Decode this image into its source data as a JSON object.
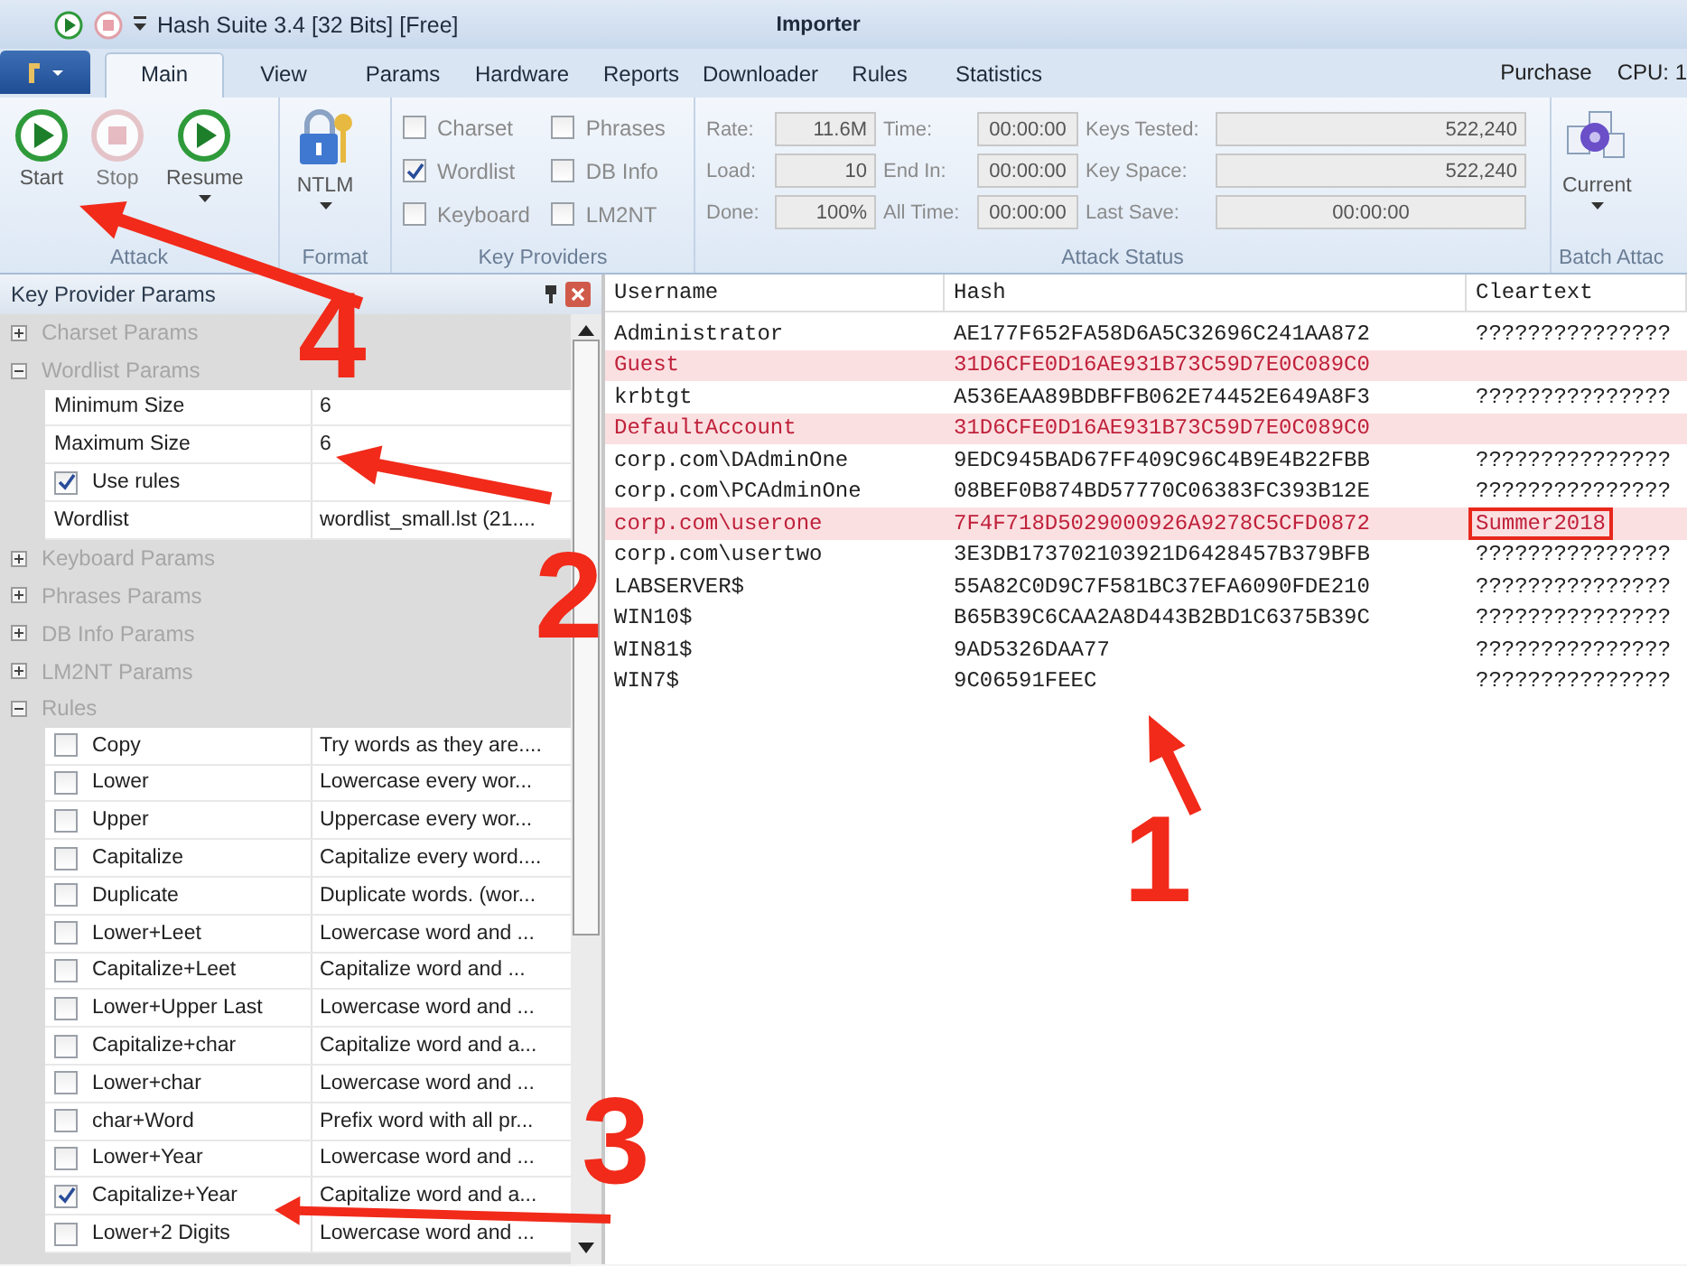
{
  "title_bar": {
    "title": "Hash Suite 3.4 [32 Bits] [Free]",
    "context": "Importer"
  },
  "tabs": [
    {
      "label": "Main",
      "selected": true
    },
    {
      "label": "View",
      "selected": false
    },
    {
      "label": "Params",
      "selected": false
    },
    {
      "label": "Hardware",
      "selected": false
    },
    {
      "label": "Reports",
      "selected": false
    },
    {
      "label": "Downloader",
      "selected": false
    },
    {
      "label": "Rules",
      "selected": false
    },
    {
      "label": "Statistics",
      "selected": false
    }
  ],
  "tab_bar_right": {
    "purchase": "Purchase",
    "cpu": "CPU: 1"
  },
  "ribbon": {
    "attack": {
      "caption": "Attack",
      "buttons": [
        {
          "label": "Start",
          "kind": "play",
          "disabled": false
        },
        {
          "label": "Stop",
          "kind": "stop",
          "disabled": true
        },
        {
          "label": "Resume",
          "kind": "play",
          "disabled": false
        }
      ]
    },
    "format": {
      "caption": "Format",
      "button": "NTLM"
    },
    "key_providers": {
      "caption": "Key Providers",
      "items": [
        {
          "label": "Charset",
          "checked": false
        },
        {
          "label": "Wordlist",
          "checked": true
        },
        {
          "label": "Keyboard",
          "checked": false
        },
        {
          "label": "Phrases",
          "checked": false
        },
        {
          "label": "DB Info",
          "checked": false
        },
        {
          "label": "LM2NT",
          "checked": false
        }
      ]
    },
    "attack_status": {
      "caption": "Attack Status",
      "fields": [
        {
          "label": "Rate:",
          "value": "11.6M"
        },
        {
          "label": "Load:",
          "value": "10"
        },
        {
          "label": "Done:",
          "value": "100%"
        },
        {
          "label": "Time:",
          "value": "00:00:00"
        },
        {
          "label": "End In:",
          "value": "00:00:00"
        },
        {
          "label": "All Time:",
          "value": "00:00:00"
        },
        {
          "label": "Keys Tested:",
          "value": "522,240"
        },
        {
          "label": "Key Space:",
          "value": "522,240"
        },
        {
          "label": "Last Save:",
          "value": "00:00:00"
        }
      ]
    },
    "batch": {
      "caption": "Batch Attac",
      "button": "Current"
    }
  },
  "params_panel": {
    "title": "Key Provider Params",
    "sections": [
      {
        "label": "Charset Params",
        "expanded": false
      },
      {
        "label": "Wordlist Params",
        "expanded": true,
        "properties": [
          {
            "kind": "value",
            "name": "Minimum Size",
            "value": "6"
          },
          {
            "kind": "value",
            "name": "Maximum Size",
            "value": "6"
          },
          {
            "kind": "check",
            "name": "Use rules",
            "checked": true
          },
          {
            "kind": "value",
            "name": "Wordlist",
            "value": "wordlist_small.lst (21...."
          }
        ]
      },
      {
        "label": "Keyboard Params",
        "expanded": false
      },
      {
        "label": "Phrases Params",
        "expanded": false
      },
      {
        "label": "DB Info Params",
        "expanded": false
      },
      {
        "label": "LM2NT Params",
        "expanded": false
      },
      {
        "label": "Rules",
        "expanded": true,
        "properties": [
          {
            "kind": "check",
            "name": "Copy",
            "checked": false,
            "value": "Try words as they are...."
          },
          {
            "kind": "check",
            "name": "Lower",
            "checked": false,
            "value": "Lowercase every wor..."
          },
          {
            "kind": "check",
            "name": "Upper",
            "checked": false,
            "value": "Uppercase every wor..."
          },
          {
            "kind": "check",
            "name": "Capitalize",
            "checked": false,
            "value": "Capitalize every word...."
          },
          {
            "kind": "check",
            "name": "Duplicate",
            "checked": false,
            "value": "Duplicate words. (wor..."
          },
          {
            "kind": "check",
            "name": "Lower+Leet",
            "checked": false,
            "value": "Lowercase word and ..."
          },
          {
            "kind": "check",
            "name": "Capitalize+Leet",
            "checked": false,
            "value": "Capitalize word and ..."
          },
          {
            "kind": "check",
            "name": "Lower+Upper Last",
            "checked": false,
            "value": "Lowercase word and ..."
          },
          {
            "kind": "check",
            "name": "Capitalize+char",
            "checked": false,
            "value": "Capitalize word and a..."
          },
          {
            "kind": "check",
            "name": "Lower+char",
            "checked": false,
            "value": "Lowercase word and ..."
          },
          {
            "kind": "check",
            "name": "char+Word",
            "checked": false,
            "value": "Prefix word with all pr..."
          },
          {
            "kind": "check",
            "name": "Lower+Year",
            "checked": false,
            "value": "Lowercase word and ..."
          },
          {
            "kind": "check",
            "name": "Capitalize+Year",
            "checked": true,
            "value": "Capitalize word and a..."
          },
          {
            "kind": "check",
            "name": "Lower+2 Digits",
            "checked": false,
            "value": "Lowercase word and ..."
          }
        ]
      }
    ]
  },
  "table": {
    "columns": [
      "Username",
      "Hash",
      "Cleartext"
    ],
    "rows": [
      {
        "cells": [
          "Administrator",
          "AE177F652FA58D6A5C32696C241AA872",
          "???????????????"
        ],
        "highlighted": false
      },
      {
        "cells": [
          "Guest",
          "31D6CFE0D16AE931B73C59D7E0C089C0"
        ],
        "highlighted": true
      },
      {
        "cells": [
          "krbtgt",
          "A536EAA89BDBFFB062E74452E649A8F3",
          "???????????????"
        ],
        "highlighted": false
      },
      {
        "cells": [
          "DefaultAccount",
          "31D6CFE0D16AE931B73C59D7E0C089C0"
        ],
        "highlighted": true
      },
      {
        "cells": [
          "corp.com\\DAdminOne",
          "9EDC945BAD67FF409C96C4B9E4B22FBB",
          "???????????????"
        ],
        "highlighted": false
      },
      {
        "cells": [
          "corp.com\\PCAdminOne",
          "08BEF0B874BD57770C06383FC393B12E",
          "???????????????"
        ],
        "highlighted": false
      },
      {
        "cells": [
          "corp.com\\userone",
          "7F4F718D5029000926A9278C5CFD0872",
          "Summer2018"
        ],
        "highlighted": true,
        "outlined": true
      },
      {
        "cells": [
          "corp.com\\usertwo",
          "3E3DB173702103921D6428457B379BFB",
          "???????????????"
        ],
        "highlighted": false
      },
      {
        "cells": [
          "LABSERVER$",
          "55A82C0D9C7F581BC37EFA6090FDE210",
          "???????????????"
        ],
        "highlighted": false
      },
      {
        "cells": [
          "WIN10$",
          "B65B39C6CAA2A8D443B2BD1C6375B39C",
          "???????????????"
        ],
        "highlighted": false
      },
      {
        "cells": [
          "WIN81$",
          "9AD5326DAA77",
          "???????????????"
        ],
        "highlighted": false
      },
      {
        "cells": [
          "WIN7$",
          "9C06591FEEC",
          "???????????????"
        ],
        "highlighted": false
      }
    ]
  },
  "annotations": [
    {
      "number": "4"
    },
    {
      "number": "2"
    },
    {
      "number": "1"
    },
    {
      "number": "3"
    }
  ]
}
